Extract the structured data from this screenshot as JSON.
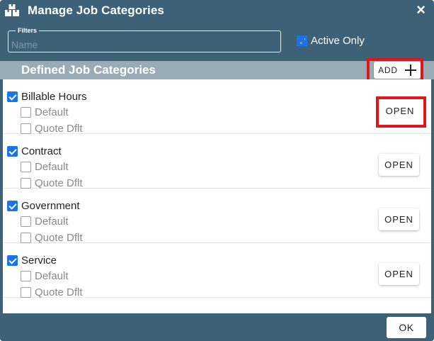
{
  "dialog": {
    "title": "Manage Job Categories",
    "close_icon": "×"
  },
  "filters": {
    "legend": "Filters",
    "name_placeholder": "Name",
    "name_value": "",
    "active_only_label": "Active Only",
    "active_only_checked": true
  },
  "section": {
    "title": "Defined Job Categories",
    "add_label": "ADD"
  },
  "categories": [
    {
      "name": "Billable Hours",
      "checked": true,
      "default_label": "Default",
      "default_checked": false,
      "quote_label": "Quote Dflt",
      "quote_checked": false,
      "open_label": "OPEN"
    },
    {
      "name": "Contract",
      "checked": true,
      "default_label": "Default",
      "default_checked": false,
      "quote_label": "Quote Dflt",
      "quote_checked": false,
      "open_label": "OPEN"
    },
    {
      "name": "Government",
      "checked": true,
      "default_label": "Default",
      "default_checked": false,
      "quote_label": "Quote Dflt",
      "quote_checked": false,
      "open_label": "OPEN"
    },
    {
      "name": "Service",
      "checked": true,
      "default_label": "Default",
      "default_checked": false,
      "quote_label": "Quote Dflt",
      "quote_checked": false,
      "open_label": "OPEN"
    }
  ],
  "footer": {
    "ok_label": "OK"
  },
  "colors": {
    "titlebar": "#3d6278",
    "section_header": "#9aabb5",
    "checkbox_accent": "#1a73e8",
    "highlight": "#e0161e"
  },
  "icons": {
    "app": "boxes-icon",
    "close": "close-icon",
    "add": "plus-icon"
  }
}
